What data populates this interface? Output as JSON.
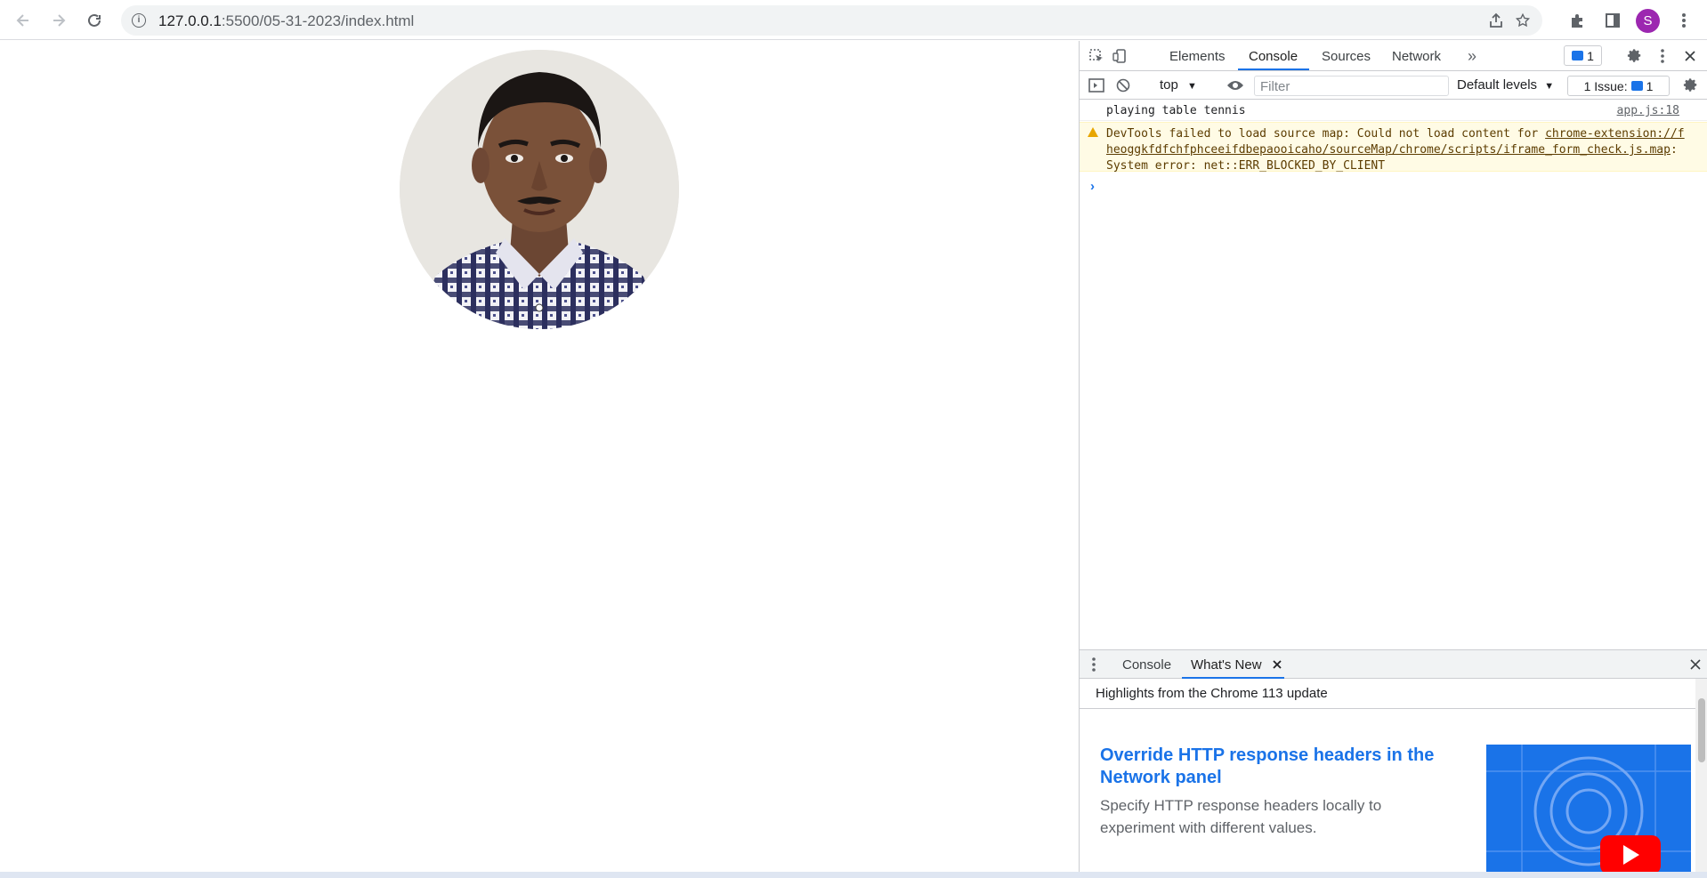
{
  "browser": {
    "url_host": "127.0.0.1",
    "url_path": ":5500/05-31-2023/index.html",
    "profile_initial": "S"
  },
  "devtools": {
    "tabs": [
      "Elements",
      "Console",
      "Sources",
      "Network"
    ],
    "active_tab": "Console",
    "issues_count": "1",
    "context": "top",
    "filter_placeholder": "Filter",
    "levels_label": "Default levels",
    "issues_label": "1 Issue:",
    "issues_badge": "1",
    "logs": [
      {
        "text": "playing table tennis",
        "source": "app.js:18"
      },
      {
        "prefix": "DevTools failed to load source map: Could not load content for ",
        "link": "chrome-extension://fheoggkfdfchfphceeifdbepaooicaho/sourceMap/chrome/scripts/iframe_form_check.js.map",
        "suffix": ": System error: net::ERR_BLOCKED_BY_CLIENT"
      }
    ],
    "drawer": {
      "tabs": [
        "Console",
        "What's New"
      ],
      "active_tab": "What's New",
      "header": "Highlights from the Chrome 113 update",
      "feature_title": "Override HTTP response headers in the Network panel",
      "feature_desc": "Specify HTTP response headers locally to experiment with different values."
    }
  },
  "colors": {
    "accent": "#1a73e8",
    "avatar": "#9c27b0",
    "warning_bg": "#fffbe5"
  }
}
